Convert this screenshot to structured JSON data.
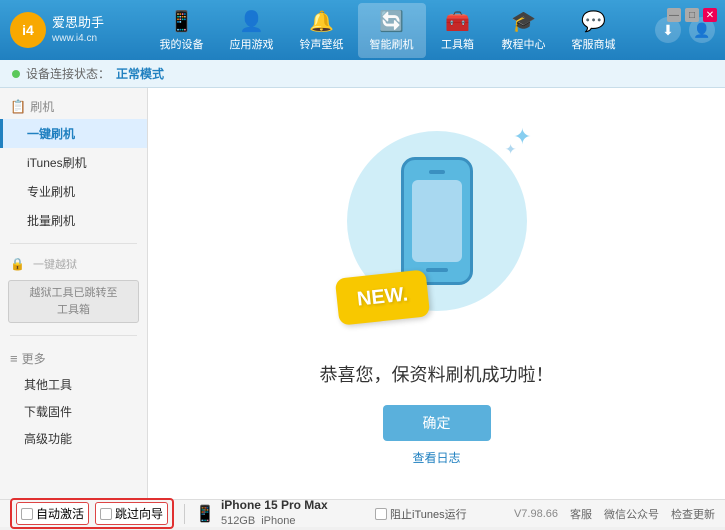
{
  "app": {
    "logo_initials": "i4",
    "logo_line1": "爱思助手",
    "logo_line2": "www.i4.cn"
  },
  "nav": {
    "items": [
      {
        "id": "my-device",
        "label": "我的设备",
        "icon": "📱"
      },
      {
        "id": "apps",
        "label": "应用游戏",
        "icon": "👤"
      },
      {
        "id": "ringtones",
        "label": "铃声壁纸",
        "icon": "🔔"
      },
      {
        "id": "smart-flash",
        "label": "智能刷机",
        "icon": "🔄",
        "active": true
      },
      {
        "id": "toolbox",
        "label": "工具箱",
        "icon": "🧰"
      },
      {
        "id": "tutorials",
        "label": "教程中心",
        "icon": "🎓"
      },
      {
        "id": "service",
        "label": "客服商城",
        "icon": "💬"
      }
    ]
  },
  "status": {
    "label": "设备连接状态：",
    "mode": "正常模式"
  },
  "sidebar": {
    "section_flash": "刷机",
    "items_flash": [
      {
        "id": "one-click",
        "label": "一键刷机",
        "active": true
      },
      {
        "id": "itunes-flash",
        "label": "iTunes刷机"
      },
      {
        "id": "pro-flash",
        "label": "专业刷机"
      },
      {
        "id": "batch-flash",
        "label": "批量刷机"
      }
    ],
    "section_jailbreak": "一键越狱",
    "jailbreak_notice": "越狱工具已跳转至\n工具箱",
    "section_more": "更多",
    "items_more": [
      {
        "id": "other-tools",
        "label": "其他工具"
      },
      {
        "id": "download-firmware",
        "label": "下载固件"
      },
      {
        "id": "advanced",
        "label": "高级功能"
      }
    ]
  },
  "content": {
    "new_badge": "NEW.",
    "success_text": "恭喜您，保资料刷机成功啦！",
    "confirm_btn": "确定",
    "log_link": "查看日志"
  },
  "bottom": {
    "auto_activate_label": "自动激活",
    "guide_activate_label": "跳过向导",
    "device_name": "iPhone 15 Pro Max",
    "device_storage": "512GB",
    "device_type": "iPhone",
    "itunes_label": "阻止iTunes运行",
    "version": "V7.98.66",
    "links": [
      "客服",
      "微信公众号",
      "检查更新"
    ]
  },
  "win_controls": {
    "min": "—",
    "max": "□",
    "close": "✕"
  }
}
